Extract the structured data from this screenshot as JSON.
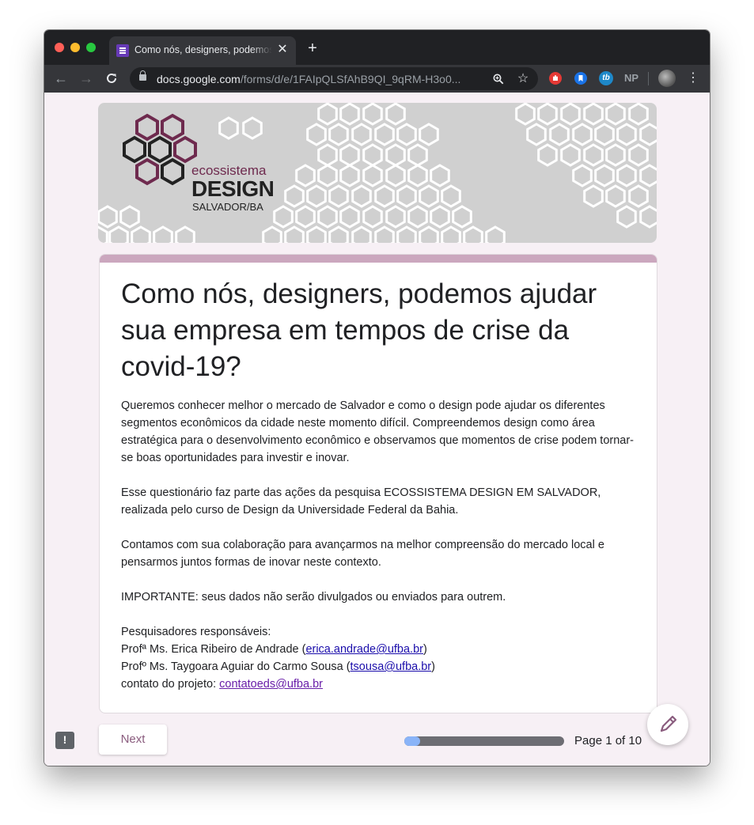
{
  "browser": {
    "tab": {
      "title": "Como nós, designers, podemos ajudar sua empresa em tempos de crise da covid-19?"
    },
    "url": {
      "domain": "docs.google.com",
      "path": "/forms/d/e/1FAIpQLSfAhB9QI_9qRM-H3o0..."
    },
    "extensions": [
      {
        "name": "stop-extension",
        "color": "#e53935"
      },
      {
        "name": "bookmark-extension",
        "color": "#1a73e8"
      },
      {
        "name": "tb-extension",
        "label": "tb",
        "color": "#1e88c9"
      },
      {
        "name": "np-extension",
        "label": "NP"
      }
    ]
  },
  "banner": {
    "logo_line1": "ecossistema",
    "logo_line2": "DESIGN",
    "logo_line3": "SALVADOR/BA",
    "accent_color": "#6e2a4e"
  },
  "form": {
    "title": "Como nós, designers, podemos ajudar sua empresa em tempos de crise da covid-19?",
    "accent_color": "#cba7be",
    "description": {
      "p1": "Queremos conhecer melhor o mercado de Salvador e como o design pode ajudar os diferentes segmentos econômicos da cidade neste momento difícil. Compreendemos design como área estratégica para o desenvolvimento econômico e observamos que momentos de crise podem tornar-se boas oportunidades para investir e inovar.",
      "p2": "Esse questionário faz parte das ações da pesquisa ECOSSISTEMA DESIGN EM SALVADOR, realizada pelo curso de Design da Universidade Federal da Bahia.",
      "p3": "Contamos com sua colaboração para avançarmos na melhor compreensão do mercado local e pensarmos juntos formas de inovar neste contexto.",
      "p4": "IMPORTANTE: seus dados não serão divulgados ou enviados para outrem.",
      "researchers_heading": "Pesquisadores responsáveis:",
      "r1_prefix": "Profª Ms. Erica Ribeiro de Andrade (",
      "r1_email": "erica.andrade@ufba.br",
      "r2_prefix": "Profº Ms. Taygoara Aguiar do Carmo Sousa (",
      "r2_email": "tsousa@ufba.br",
      "contact_prefix": "contato do projeto: ",
      "contact_email": "contatoeds@ufba.br",
      "close_paren": ")"
    }
  },
  "footer": {
    "next_label": "Next",
    "page_label": "Page 1 of 10",
    "progress": 0.1,
    "progress_color": "#8ab4f8"
  }
}
